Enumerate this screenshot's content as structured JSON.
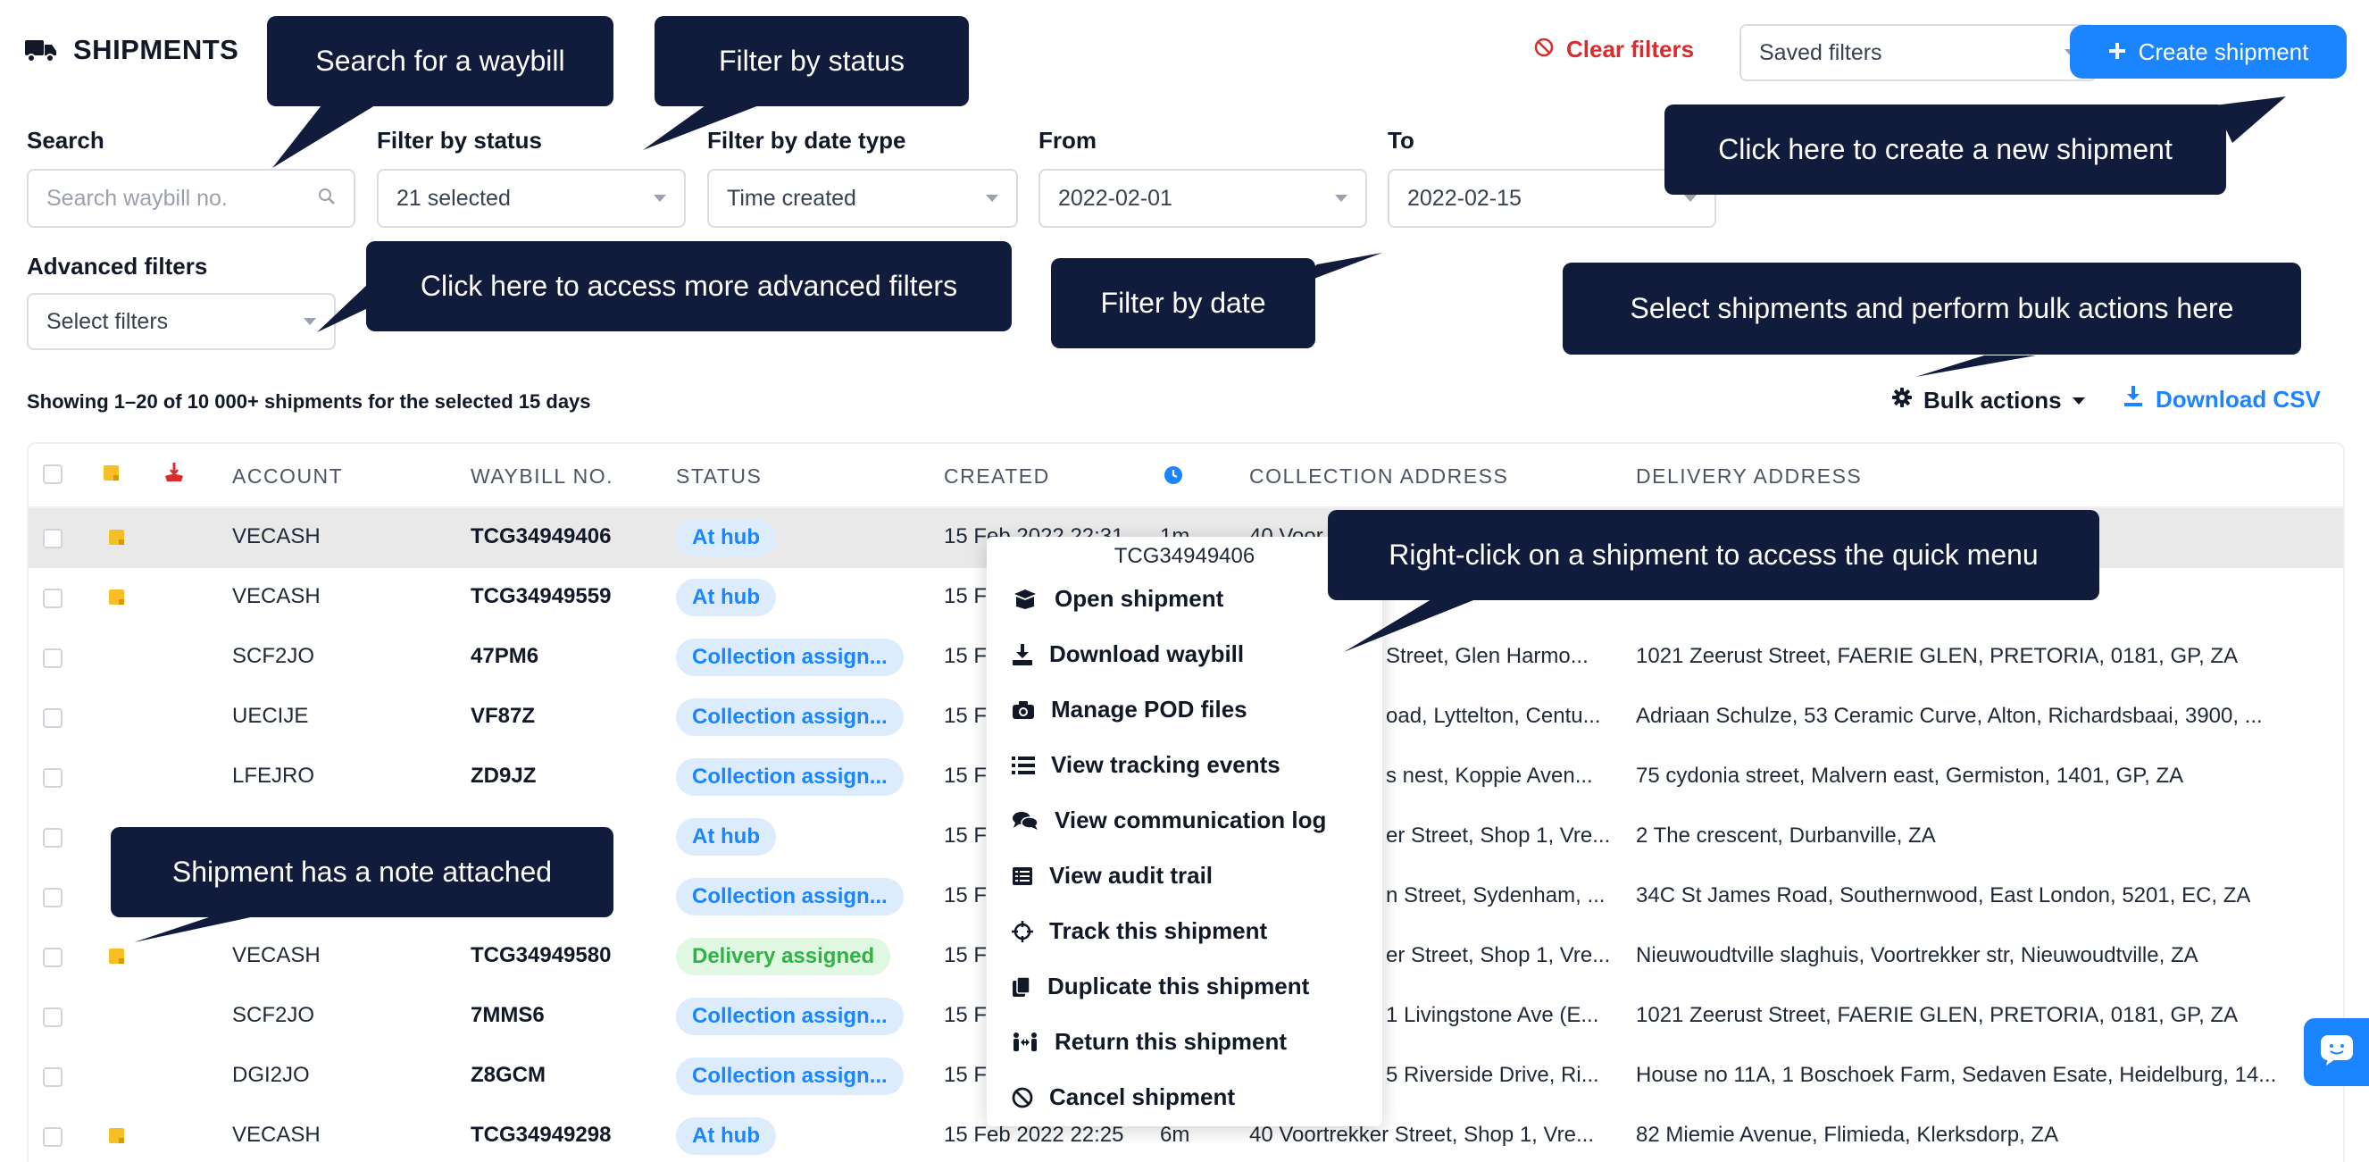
{
  "header": {
    "title": "SHIPMENTS",
    "clear_filters": "Clear filters",
    "saved_filters": "Saved filters",
    "create_shipment": "Create shipment"
  },
  "filters": {
    "search_label": "Search",
    "search_placeholder": "Search waybill no.",
    "status_label": "Filter by status",
    "status_value": "21 selected",
    "date_type_label": "Filter by date type",
    "date_type_value": "Time created",
    "from_label": "From",
    "from_value": "2022-02-01",
    "to_label": "To",
    "to_value": "2022-02-15",
    "advanced_label": "Advanced filters",
    "advanced_value": "Select filters"
  },
  "toolbar": {
    "showing": "Showing 1–20 of 10 000+ shipments for the selected 15 days",
    "bulk_actions": "Bulk actions",
    "download_csv": "Download CSV"
  },
  "table": {
    "headers": [
      "ACCOUNT",
      "WAYBILL NO.",
      "STATUS",
      "CREATED",
      "COLLECTION ADDRESS",
      "DELIVERY ADDRESS"
    ],
    "rows": [
      {
        "account": "VECASH",
        "waybill": "TCG34949406",
        "status": "At hub",
        "created": "15 Feb 2022 22:31",
        "age": "1m",
        "collection": "40 Voor",
        "delivery": ""
      },
      {
        "account": "VECASH",
        "waybill": "TCG34949559",
        "status": "At hub",
        "created": "15 Fe",
        "age": "",
        "collection": "",
        "delivery": ""
      },
      {
        "account": "SCF2JO",
        "waybill": "47PM6",
        "status": "Collection assign...",
        "created": "15 Fe",
        "age": "",
        "collection": "Street, Glen Harmo...",
        "delivery": "1021 Zeerust Street, FAERIE GLEN, PRETORIA, 0181, GP, ZA"
      },
      {
        "account": "UECIJE",
        "waybill": "VF87Z",
        "status": "Collection assign...",
        "created": "15 Fe",
        "age": "",
        "collection": "oad, Lyttelton, Centu...",
        "delivery": "Adriaan Schulze, 53 Ceramic Curve, Alton, Richardsbaai, 3900, ..."
      },
      {
        "account": "LFEJRO",
        "waybill": "ZD9JZ",
        "status": "Collection assign...",
        "created": "15 Fe",
        "age": "",
        "collection": "s nest, Koppie Aven...",
        "delivery": "75 cydonia street, Malvern east, Germiston, 1401, GP, ZA"
      },
      {
        "account": "",
        "waybill": "",
        "status": "At hub",
        "created": "15 Fe",
        "age": "",
        "collection": "er Street, Shop 1, Vre...",
        "delivery": "2 The crescent, Durbanville, ZA"
      },
      {
        "account": "",
        "waybill": "",
        "status": "Collection assign...",
        "created": "15 Fe",
        "age": "",
        "collection": "n Street, Sydenham, ...",
        "delivery": "34C St James Road, Southernwood, East London, 5201, EC, ZA"
      },
      {
        "account": "VECASH",
        "waybill": "TCG34949580",
        "status": "Delivery assigned",
        "created": "15 Fe",
        "age": "",
        "collection": "er Street, Shop 1, Vre...",
        "delivery": "Nieuwoudtville slaghuis, Voortrekker str, Nieuwoudtville, ZA"
      },
      {
        "account": "SCF2JO",
        "waybill": "7MMS6",
        "status": "Collection assign...",
        "created": "15 Fe",
        "age": "",
        "collection": "1 Livingstone Ave (E...",
        "delivery": "1021 Zeerust Street, FAERIE GLEN, PRETORIA, 0181, GP, ZA"
      },
      {
        "account": "DGI2JO",
        "waybill": "Z8GCM",
        "status": "Collection assign...",
        "created": "15 Fe",
        "age": "",
        "collection": "5 Riverside Drive, Ri...",
        "delivery": "House no 11A, 1 Boschoek Farm, Sedaven Esate, Heidelburg, 14..."
      },
      {
        "account": "VECASH",
        "waybill": "TCG34949298",
        "status": "At hub",
        "created": "15 Feb 2022 22:25",
        "age": "6m",
        "collection": "40 Voortrekker Street, Shop 1, Vre...",
        "delivery": "82 Miemie Avenue, Flimieda, Klerksdorp, ZA"
      }
    ]
  },
  "context_menu": {
    "waybill": "TCG34949406",
    "items": [
      "Open shipment",
      "Download waybill",
      "Manage POD files",
      "View tracking events",
      "View communication log",
      "View audit trail",
      "Track this shipment",
      "Duplicate this shipment",
      "Return this shipment",
      "Cancel shipment"
    ]
  },
  "callouts": {
    "search": "Search for a waybill",
    "status": "Filter by status",
    "create": "Click here to create a new shipment",
    "advanced": "Click here to access more advanced filters",
    "date": "Filter by date",
    "bulk": "Select shipments and perform bulk actions here",
    "rightclick": "Right-click on a shipment to access the quick menu",
    "note": "Shipment has a note attached"
  },
  "colors": {
    "accent": "#1a85ff",
    "danger": "#d92d2d",
    "callout_bg": "#111b3c",
    "note": "#f6bf26",
    "badge_blue_bg": "#dcecfd",
    "badge_green_bg": "#e0f7e1",
    "badge_green_text": "#2fb347"
  }
}
